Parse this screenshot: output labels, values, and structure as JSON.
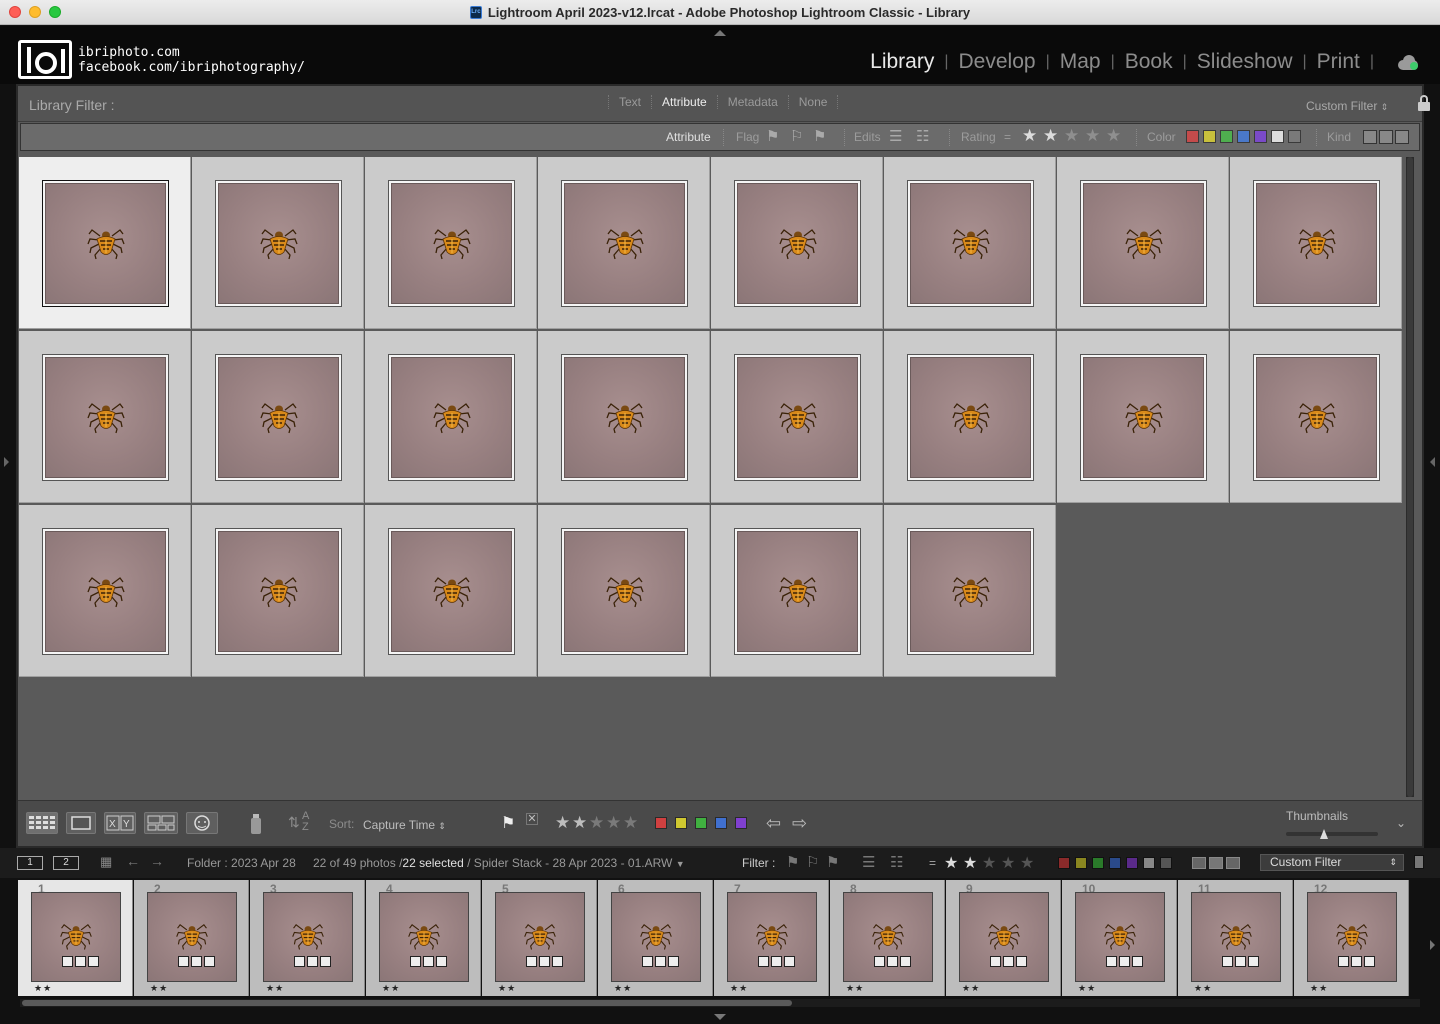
{
  "window": {
    "title": "Lightroom April 2023-v12.lrcat - Adobe Photoshop Lightroom Classic - Library",
    "app_icon": "Lrc"
  },
  "identity": {
    "line1": "ibriphoto.com",
    "line2": "facebook.com/ibriphotography/"
  },
  "modules": [
    "Library",
    "Develop",
    "Map",
    "Book",
    "Slideshow",
    "Print"
  ],
  "active_module": "Library",
  "library_filter": {
    "label": "Library Filter :",
    "tabs": [
      "Text",
      "Attribute",
      "Metadata",
      "None"
    ],
    "active_tab": "Attribute",
    "preset": "Custom Filter"
  },
  "attribute_bar": {
    "attribute_label": "Attribute",
    "flag_label": "Flag",
    "edits_label": "Edits",
    "rating_label": "Rating",
    "rating_op": "=",
    "rating_stars": 2,
    "color_label": "Color",
    "kind_label": "Kind",
    "colors": [
      "#c44b4b",
      "#c8c03c",
      "#4fae4f",
      "#4a78c8",
      "#7a4ac8",
      "#dddddd",
      "#7a7a7a"
    ]
  },
  "grid": {
    "total_cells": 22,
    "selected_index": 0,
    "columns": 8
  },
  "toolbar": {
    "sort_label": "Sort:",
    "sort_value": "Capture Time",
    "rating_stars": 2,
    "colors": [
      "#d04040",
      "#d0c830",
      "#40b040",
      "#4070d0",
      "#8040d0"
    ],
    "thumbnails_label": "Thumbnails"
  },
  "filmstrip_header": {
    "view1": "1",
    "view2": "2",
    "folder": "Folder : 2023 Apr 28",
    "count": "22 of 49 photos /",
    "selected": "22 selected",
    "file": "/ Spider Stack - 28 Apr 2023 - 01.ARW",
    "filter_label": "Filter :",
    "rating_op": "=",
    "rating_stars": 2,
    "preset": "Custom Filter",
    "colors": [
      "#8a2a2a",
      "#8a8620",
      "#2a7a2a",
      "#2a4a8a",
      "#5a2a8a",
      "#888888",
      "#555555"
    ]
  },
  "filmstrip": {
    "numbers": [
      "1",
      "2",
      "3",
      "4",
      "5",
      "6",
      "7",
      "8",
      "9",
      "10",
      "11",
      "12"
    ],
    "stars": "★★",
    "selected_index": 0
  }
}
